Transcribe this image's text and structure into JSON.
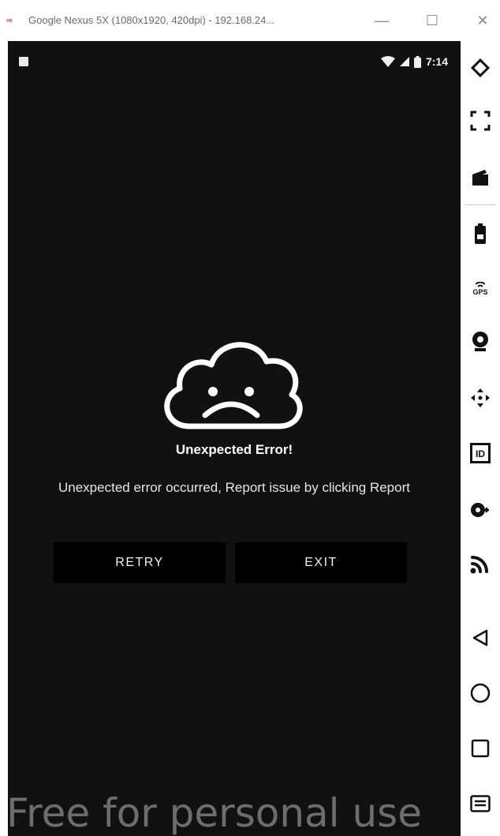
{
  "window": {
    "title": "Google Nexus 5X (1080x1920, 420dpi) - 192.168.24...",
    "app_icon_glyph": "∞",
    "minimize": "—",
    "maximize": "☐",
    "close": "✕"
  },
  "status_bar": {
    "time": "7:14",
    "icons": [
      "notification-icon",
      "wifi-icon",
      "cell-signal-icon",
      "battery-icon"
    ]
  },
  "error": {
    "title": "Unexpected Error!",
    "message": "Unexpected error occurred, Report issue by clicking Report",
    "icon": "sad-cloud-icon",
    "retry_label": "RETRY",
    "exit_label": "EXIT"
  },
  "toolbar": {
    "icons": [
      "rotate-icon",
      "fullscreen-icon",
      "screen-record-icon",
      "battery-icon",
      "gps-icon",
      "camera-icon",
      "move-icon",
      "identify-icon",
      "media-icon",
      "cast-icon",
      "back-icon",
      "home-icon",
      "recents-icon",
      "menu-icon"
    ],
    "gps_label": "GPS",
    "id_label": "ID"
  },
  "watermark": "Free for personal use",
  "colors": {
    "screen_bg": "#111111",
    "button_bg": "#000000",
    "text": "#ffffff",
    "window_bg": "#ffffff"
  }
}
